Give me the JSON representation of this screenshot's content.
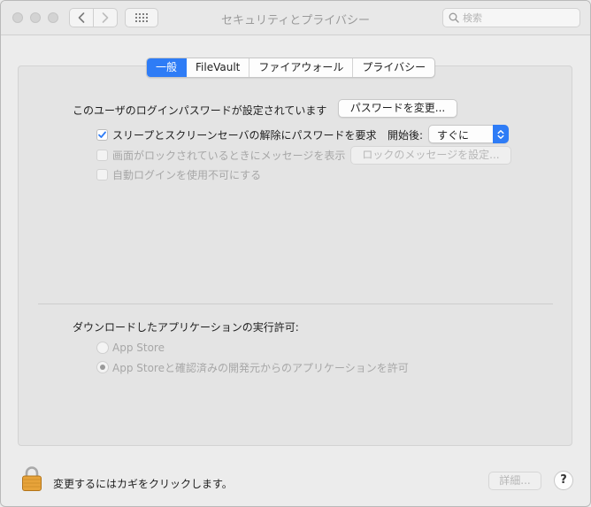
{
  "window": {
    "title": "セキュリティとプライバシー",
    "search_placeholder": "検索"
  },
  "tabs": [
    {
      "label": "一般",
      "active": true
    },
    {
      "label": "FileVault",
      "active": false
    },
    {
      "label": "ファイアウォール",
      "active": false
    },
    {
      "label": "プライバシー",
      "active": false
    }
  ],
  "general": {
    "password_set_text": "このユーザのログインパスワードが設定されています",
    "change_password_button": "パスワードを変更...",
    "require_password_label": "スリープとスクリーンセーバの解除にパスワードを要求",
    "require_password_checked": true,
    "after_label": "開始後:",
    "after_value": "すぐに",
    "show_message_label": "画面がロックされているときにメッセージを表示",
    "show_message_checked": false,
    "set_lock_message_button": "ロックのメッセージを設定...",
    "disable_auto_login_label": "自動ログインを使用不可にする",
    "disable_auto_login_checked": false
  },
  "downloads": {
    "heading": "ダウンロードしたアプリケーションの実行許可:",
    "options": [
      {
        "label": "App Store",
        "selected": false
      },
      {
        "label": "App Storeと確認済みの開発元からのアプリケーションを許可",
        "selected": true
      }
    ]
  },
  "footer": {
    "lock_text": "変更するにはカギをクリックします。",
    "advanced_button": "詳細...",
    "help_label": "?"
  },
  "colors": {
    "accent": "#2e7cf6",
    "lock_gold": "#e7a33a"
  }
}
